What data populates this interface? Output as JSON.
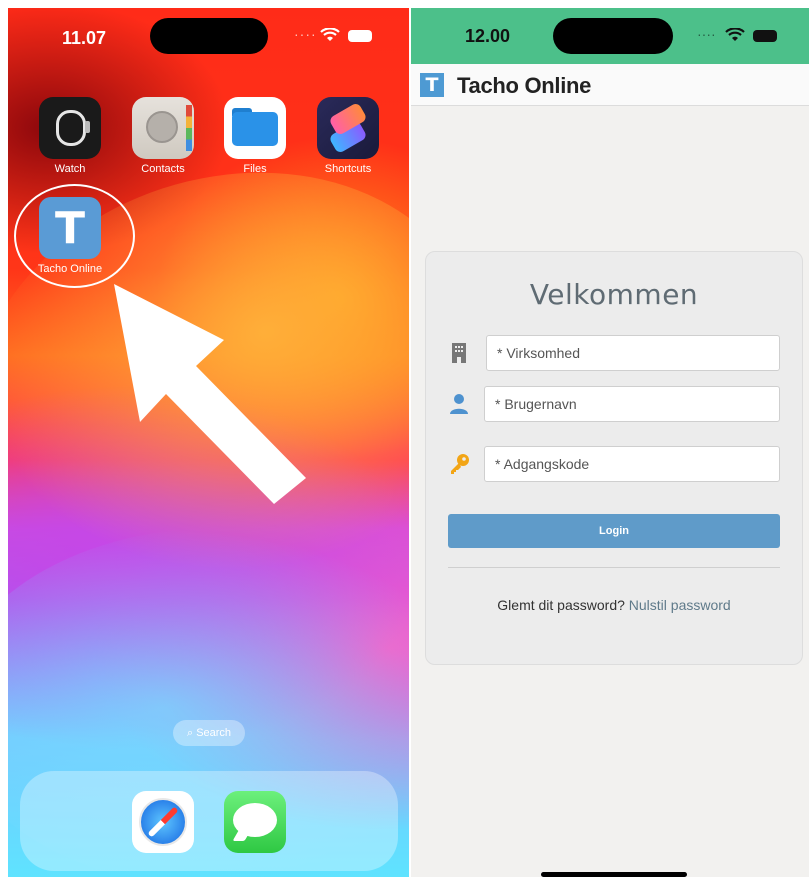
{
  "home_screen": {
    "status_time": "11.07",
    "apps": [
      {
        "label": "Watch",
        "icon": "watch-icon"
      },
      {
        "label": "Contacts",
        "icon": "contacts-icon"
      },
      {
        "label": "Files",
        "icon": "files-icon"
      },
      {
        "label": "Shortcuts",
        "icon": "shortcuts-icon"
      },
      {
        "label": "Tacho Online",
        "icon": "tacho-online-icon",
        "icon_letter": "T"
      }
    ],
    "search_label": "Search",
    "dock": [
      "safari-icon",
      "messages-icon"
    ]
  },
  "login_screen": {
    "status_time": "12.00",
    "status_bar_color": "#4cc08a",
    "app_title": "Tacho Online",
    "logo_letter": "T",
    "welcome": "Velkommen",
    "fields": {
      "company_placeholder": "* Virksomhed",
      "username_placeholder": "* Brugernavn",
      "password_placeholder": "* Adgangskode"
    },
    "login_button": "Login",
    "forgot_text": "Glemt dit password?",
    "reset_link": "Nulstil password",
    "accent_color": "#5f9bc9"
  }
}
